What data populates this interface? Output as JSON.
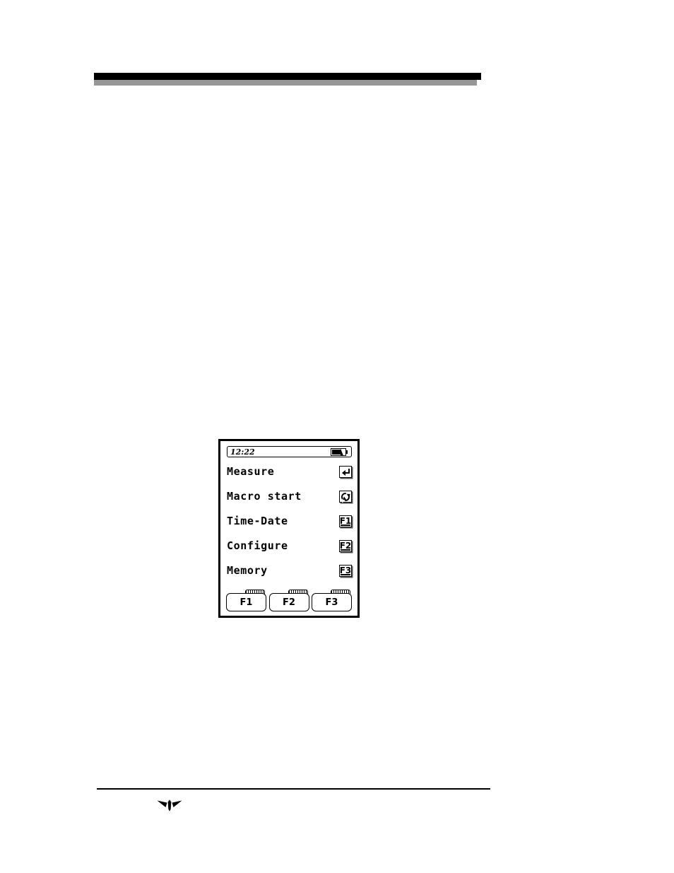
{
  "page": {
    "header_rule": {
      "name": "decorative-header-bars",
      "accent_black": "#000000",
      "accent_gray": "#969696"
    },
    "footer": {
      "rule_color": "#000000",
      "logo_name": "teledyne-logo"
    }
  },
  "device": {
    "name": "handheld-instrument-lcd",
    "statusbar": {
      "clock": "12:22",
      "battery": {
        "icon": "battery-icon",
        "segments_filled": 3,
        "segments_total": 4
      }
    },
    "menu": {
      "items": [
        {
          "label": "Measure",
          "key_glyph": "enter-arrow-icon",
          "key_text": ""
        },
        {
          "label": "Macro start",
          "key_glyph": "macro-circle-icon",
          "key_text": ""
        },
        {
          "label": "Time-Date",
          "key_glyph": "function-key-icon",
          "key_text": "F1"
        },
        {
          "label": "Configure",
          "key_glyph": "function-key-icon",
          "key_text": "F2"
        },
        {
          "label": "Memory",
          "key_glyph": "function-key-icon",
          "key_text": "F3"
        }
      ]
    },
    "softkeys": [
      {
        "label": "F1"
      },
      {
        "label": "F2"
      },
      {
        "label": "F3"
      }
    ]
  }
}
